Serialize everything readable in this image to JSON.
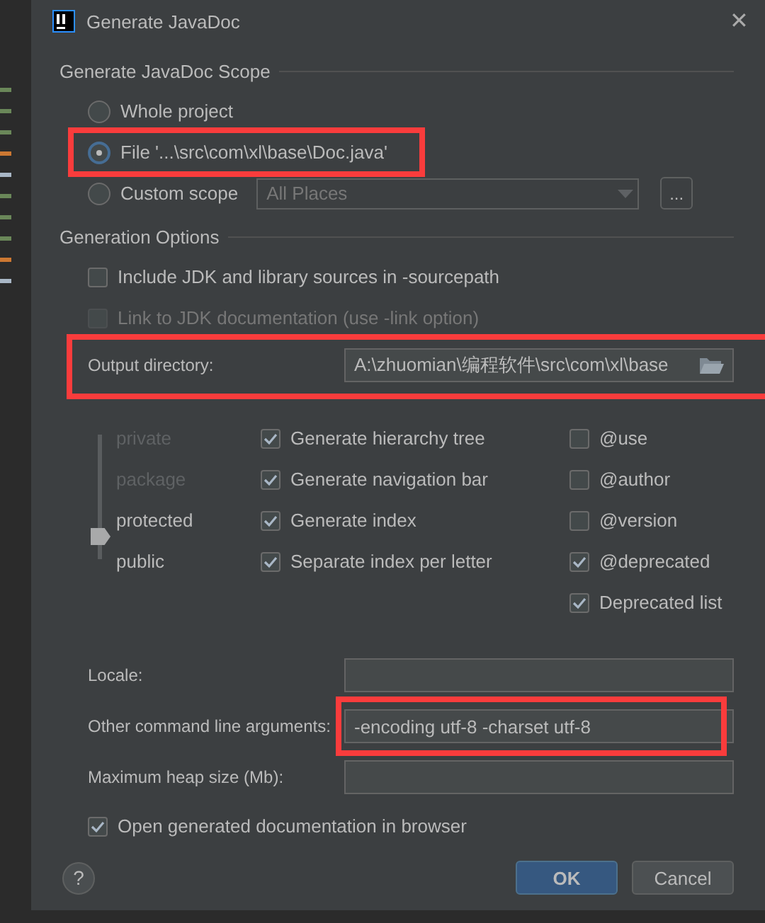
{
  "window": {
    "title": "Generate JavaDoc",
    "close": "✕"
  },
  "scope": {
    "heading": "Generate JavaDoc Scope",
    "options": [
      {
        "label": "Whole project",
        "selected": false
      },
      {
        "label": "File '...\\src\\com\\xl\\base\\Doc.java'",
        "selected": true,
        "highlighted": true
      },
      {
        "label": "Custom scope",
        "selected": false,
        "dropdown": "All Places",
        "more": "..."
      }
    ]
  },
  "generation": {
    "heading": "Generation Options",
    "checks": [
      {
        "label": "Include JDK and library sources in -sourcepath",
        "checked": false,
        "disabled": false
      },
      {
        "label": "Link to JDK documentation (use -link option)",
        "checked": false,
        "disabled": true
      }
    ],
    "output_directory": {
      "label": "Output directory:",
      "value": "A:\\zhuomian\\编程软件\\src\\com\\xl\\base",
      "highlighted": true
    },
    "access_levels": [
      {
        "label": "private",
        "selected": false
      },
      {
        "label": "package",
        "selected": false
      },
      {
        "label": "protected",
        "selected": true
      },
      {
        "label": "public",
        "selected": false
      }
    ],
    "options": [
      {
        "label": "Generate hierarchy tree",
        "checked": true
      },
      {
        "label": "Generate navigation bar",
        "checked": true
      },
      {
        "label": "Generate index",
        "checked": true
      },
      {
        "label": "Separate index per letter",
        "checked": true
      }
    ],
    "tags": [
      {
        "label": "@use",
        "checked": false
      },
      {
        "label": "@author",
        "checked": false
      },
      {
        "label": "@version",
        "checked": false
      },
      {
        "label": "@deprecated",
        "checked": true
      },
      {
        "label": "Deprecated list",
        "checked": true
      }
    ],
    "fields": [
      {
        "label": "Locale:"
      },
      {
        "label": "Other command line arguments:",
        "value": "-encoding utf-8 -charset utf-8",
        "highlighted": true
      },
      {
        "label": "Maximum heap size (Mb):"
      }
    ],
    "open_in_browser": {
      "label": "Open generated documentation in browser",
      "checked": true
    }
  },
  "buttons": {
    "help": "?",
    "ok": "OK",
    "cancel": "Cancel"
  }
}
